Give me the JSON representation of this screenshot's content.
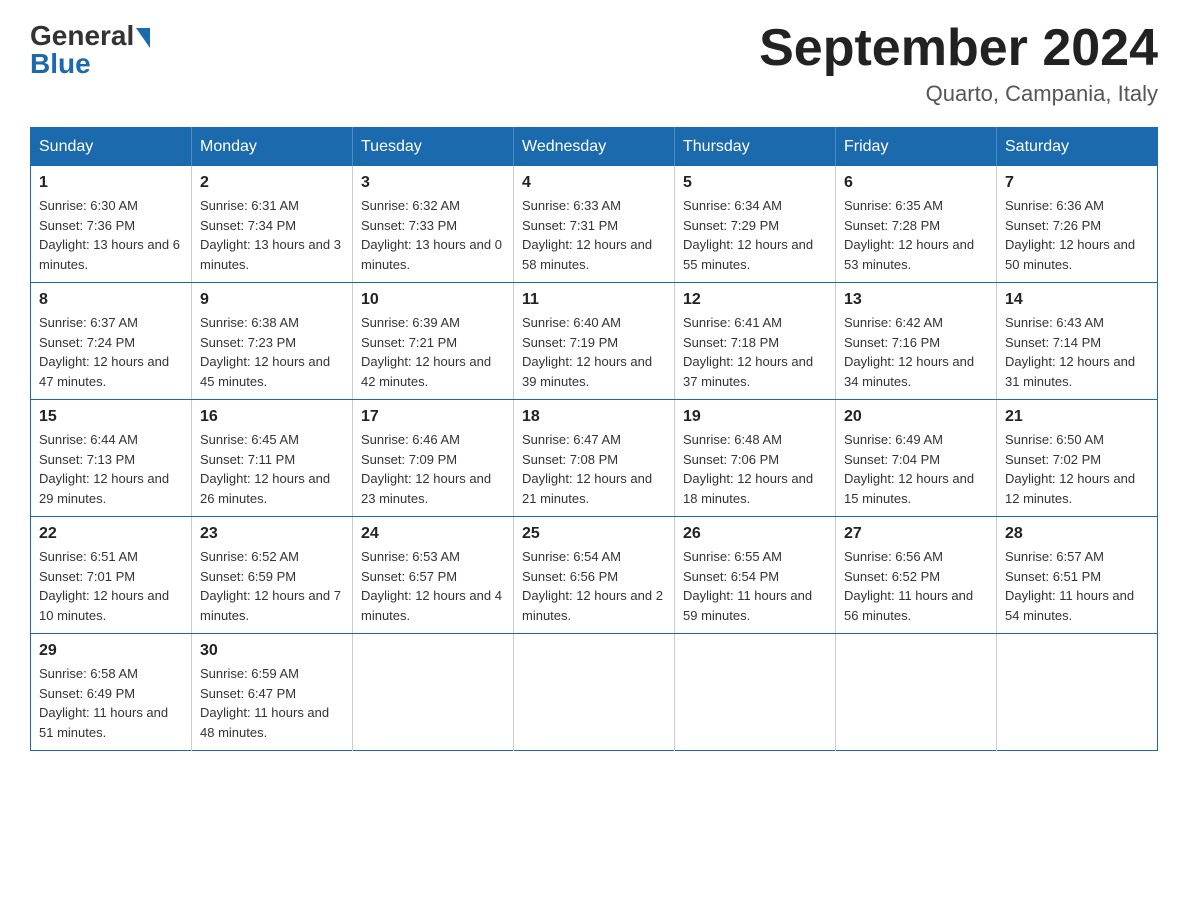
{
  "logo": {
    "general": "General",
    "blue": "Blue"
  },
  "header": {
    "title": "September 2024",
    "location": "Quarto, Campania, Italy"
  },
  "days_of_week": [
    "Sunday",
    "Monday",
    "Tuesday",
    "Wednesday",
    "Thursday",
    "Friday",
    "Saturday"
  ],
  "weeks": [
    [
      {
        "day": "1",
        "sunrise": "6:30 AM",
        "sunset": "7:36 PM",
        "daylight": "13 hours and 6 minutes."
      },
      {
        "day": "2",
        "sunrise": "6:31 AM",
        "sunset": "7:34 PM",
        "daylight": "13 hours and 3 minutes."
      },
      {
        "day": "3",
        "sunrise": "6:32 AM",
        "sunset": "7:33 PM",
        "daylight": "13 hours and 0 minutes."
      },
      {
        "day": "4",
        "sunrise": "6:33 AM",
        "sunset": "7:31 PM",
        "daylight": "12 hours and 58 minutes."
      },
      {
        "day": "5",
        "sunrise": "6:34 AM",
        "sunset": "7:29 PM",
        "daylight": "12 hours and 55 minutes."
      },
      {
        "day": "6",
        "sunrise": "6:35 AM",
        "sunset": "7:28 PM",
        "daylight": "12 hours and 53 minutes."
      },
      {
        "day": "7",
        "sunrise": "6:36 AM",
        "sunset": "7:26 PM",
        "daylight": "12 hours and 50 minutes."
      }
    ],
    [
      {
        "day": "8",
        "sunrise": "6:37 AM",
        "sunset": "7:24 PM",
        "daylight": "12 hours and 47 minutes."
      },
      {
        "day": "9",
        "sunrise": "6:38 AM",
        "sunset": "7:23 PM",
        "daylight": "12 hours and 45 minutes."
      },
      {
        "day": "10",
        "sunrise": "6:39 AM",
        "sunset": "7:21 PM",
        "daylight": "12 hours and 42 minutes."
      },
      {
        "day": "11",
        "sunrise": "6:40 AM",
        "sunset": "7:19 PM",
        "daylight": "12 hours and 39 minutes."
      },
      {
        "day": "12",
        "sunrise": "6:41 AM",
        "sunset": "7:18 PM",
        "daylight": "12 hours and 37 minutes."
      },
      {
        "day": "13",
        "sunrise": "6:42 AM",
        "sunset": "7:16 PM",
        "daylight": "12 hours and 34 minutes."
      },
      {
        "day": "14",
        "sunrise": "6:43 AM",
        "sunset": "7:14 PM",
        "daylight": "12 hours and 31 minutes."
      }
    ],
    [
      {
        "day": "15",
        "sunrise": "6:44 AM",
        "sunset": "7:13 PM",
        "daylight": "12 hours and 29 minutes."
      },
      {
        "day": "16",
        "sunrise": "6:45 AM",
        "sunset": "7:11 PM",
        "daylight": "12 hours and 26 minutes."
      },
      {
        "day": "17",
        "sunrise": "6:46 AM",
        "sunset": "7:09 PM",
        "daylight": "12 hours and 23 minutes."
      },
      {
        "day": "18",
        "sunrise": "6:47 AM",
        "sunset": "7:08 PM",
        "daylight": "12 hours and 21 minutes."
      },
      {
        "day": "19",
        "sunrise": "6:48 AM",
        "sunset": "7:06 PM",
        "daylight": "12 hours and 18 minutes."
      },
      {
        "day": "20",
        "sunrise": "6:49 AM",
        "sunset": "7:04 PM",
        "daylight": "12 hours and 15 minutes."
      },
      {
        "day": "21",
        "sunrise": "6:50 AM",
        "sunset": "7:02 PM",
        "daylight": "12 hours and 12 minutes."
      }
    ],
    [
      {
        "day": "22",
        "sunrise": "6:51 AM",
        "sunset": "7:01 PM",
        "daylight": "12 hours and 10 minutes."
      },
      {
        "day": "23",
        "sunrise": "6:52 AM",
        "sunset": "6:59 PM",
        "daylight": "12 hours and 7 minutes."
      },
      {
        "day": "24",
        "sunrise": "6:53 AM",
        "sunset": "6:57 PM",
        "daylight": "12 hours and 4 minutes."
      },
      {
        "day": "25",
        "sunrise": "6:54 AM",
        "sunset": "6:56 PM",
        "daylight": "12 hours and 2 minutes."
      },
      {
        "day": "26",
        "sunrise": "6:55 AM",
        "sunset": "6:54 PM",
        "daylight": "11 hours and 59 minutes."
      },
      {
        "day": "27",
        "sunrise": "6:56 AM",
        "sunset": "6:52 PM",
        "daylight": "11 hours and 56 minutes."
      },
      {
        "day": "28",
        "sunrise": "6:57 AM",
        "sunset": "6:51 PM",
        "daylight": "11 hours and 54 minutes."
      }
    ],
    [
      {
        "day": "29",
        "sunrise": "6:58 AM",
        "sunset": "6:49 PM",
        "daylight": "11 hours and 51 minutes."
      },
      {
        "day": "30",
        "sunrise": "6:59 AM",
        "sunset": "6:47 PM",
        "daylight": "11 hours and 48 minutes."
      },
      null,
      null,
      null,
      null,
      null
    ]
  ]
}
